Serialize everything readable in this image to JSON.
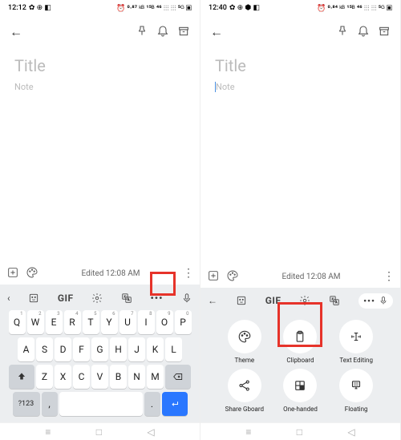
{
  "left": {
    "status": {
      "time": "12:12",
      "icons_left": "✿ ⊕ ◧",
      "icons_right": "⏰ ⁰·⁸⁷ ᵏᴮ ¹⁵ᴮ ⁴⁶ ⫶⫶⫶ ⫶⫶⫶ ⁵ᴳ ▣"
    },
    "note": {
      "title_placeholder": "Title",
      "body_placeholder": "Note"
    },
    "footer": {
      "edited": "Edited 12:08 AM"
    },
    "keyboard": {
      "row1": [
        {
          "k": "Q",
          "s": "1"
        },
        {
          "k": "W",
          "s": "2"
        },
        {
          "k": "E",
          "s": "3"
        },
        {
          "k": "R",
          "s": "4"
        },
        {
          "k": "T",
          "s": "5"
        },
        {
          "k": "Y",
          "s": "6"
        },
        {
          "k": "U",
          "s": "7"
        },
        {
          "k": "I",
          "s": "8"
        },
        {
          "k": "O",
          "s": "9"
        },
        {
          "k": "P",
          "s": "0"
        }
      ],
      "row2": [
        "A",
        "S",
        "D",
        "F",
        "G",
        "H",
        "J",
        "K",
        "L"
      ],
      "row3": [
        "Z",
        "X",
        "C",
        "V",
        "B",
        "N",
        "M"
      ],
      "row4": {
        "numkey": "?123",
        "comma": ",",
        "period": "."
      },
      "gif": "GIF"
    }
  },
  "right": {
    "status": {
      "time": "12:40",
      "icons_left": "✿ ⊕ ⬢ ◧",
      "icons_right": "⏰ ⁰·⁸⁴ ᵏᴮ ¹⁵ᴮ ⁴⁶ ⫶⫶⫶ ⫶⫶⫶ ⁵ᴳ ▣"
    },
    "note": {
      "title_placeholder": "Title",
      "body_placeholder": "Note"
    },
    "footer": {
      "edited": "Edited 12:08 AM"
    },
    "panel": {
      "gif": "GIF",
      "items": [
        {
          "label": "Theme"
        },
        {
          "label": "Clipboard"
        },
        {
          "label": "Text Editing"
        },
        {
          "label": "Share Gboard"
        },
        {
          "label": "One-handed"
        },
        {
          "label": "Floating"
        }
      ]
    }
  }
}
